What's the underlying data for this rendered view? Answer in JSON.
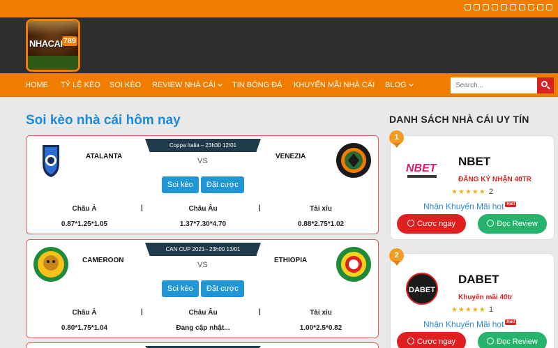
{
  "social_icons": [
    "facebook-icon",
    "instagram-icon",
    "tiktok-icon",
    "twitter-icon",
    "email-icon",
    "pinterest-icon",
    "rss-icon",
    "linkedin-icon",
    "youtube-icon",
    "vk-icon"
  ],
  "logo": {
    "brand": "NHACAI",
    "number": "789"
  },
  "nav": [
    {
      "label": "HOME"
    },
    {
      "label": "TỶ LỆ KÈO"
    },
    {
      "label": "SOI KÈO"
    },
    {
      "label": "REVIEW NHÀ CÁI"
    },
    {
      "label": "TIN BÓNG ĐÁ"
    },
    {
      "label": "KHUYẾN MÃI NHÀ CÁI"
    },
    {
      "label": "BLOG"
    }
  ],
  "search": {
    "placeholder": "Search..."
  },
  "main": {
    "title": "Soi kèo nhà cái hôm nay"
  },
  "matches": [
    {
      "league": "Coppa Italia – 23h30 12/01",
      "home": "ATALANTA",
      "away": "VENEZIA",
      "vs": "VS",
      "btn_soi": "Soi kèo",
      "btn_dat": "Đặt cược",
      "label_asia": "Châu Á",
      "label_eu": "Châu Âu",
      "label_tx": "Tài xỉu",
      "sep": "|",
      "odds_asia": "0.87*1.25*1.05",
      "odds_eu": "1.37*7.30*4.70",
      "odds_tx": "0.88*2.75*1.02"
    },
    {
      "league": "CAN CUP 2021– 23h00 13/01",
      "home": "CAMEROON",
      "away": "ETHIOPIA",
      "vs": "VS",
      "btn_soi": "Soi kèo",
      "btn_dat": "Đặt cược",
      "label_asia": "Châu Á",
      "label_eu": "Châu Âu",
      "label_tx": "Tài xỉu",
      "sep": "|",
      "odds_asia": "0.80*1.75*1.04",
      "odds_eu": "Đang cập nhật...",
      "odds_tx": "1.00*2.5*0.82"
    }
  ],
  "sidebar": {
    "title": "DANH SÁCH NHÀ CÁI UY TÍN",
    "bookies": [
      {
        "rank": "1",
        "name": "NBET",
        "promo": "ĐĂNG KÝ NHẬN 40TR",
        "stars": "★★★★★",
        "rating": "2",
        "hot_text": "Nhận Khuyến Mãi hot",
        "hot_badge": "Hot!",
        "btn_bet": "Cược ngay",
        "btn_review": "Đọc Review"
      },
      {
        "rank": "2",
        "name": "DABET",
        "promo": "Khuyến mãi 40tr",
        "stars": "★★★★★",
        "rating": "1",
        "hot_text": "Nhận Khuyến Mãi hot",
        "hot_badge": "Hot!",
        "btn_bet": "Cược ngay",
        "btn_review": "Đọc Review"
      }
    ]
  },
  "colors": {
    "orange": "#f07c00",
    "dark": "#2e2e2e",
    "blue": "#1e8ad6",
    "red": "#e02020",
    "green": "#26b36b"
  }
}
